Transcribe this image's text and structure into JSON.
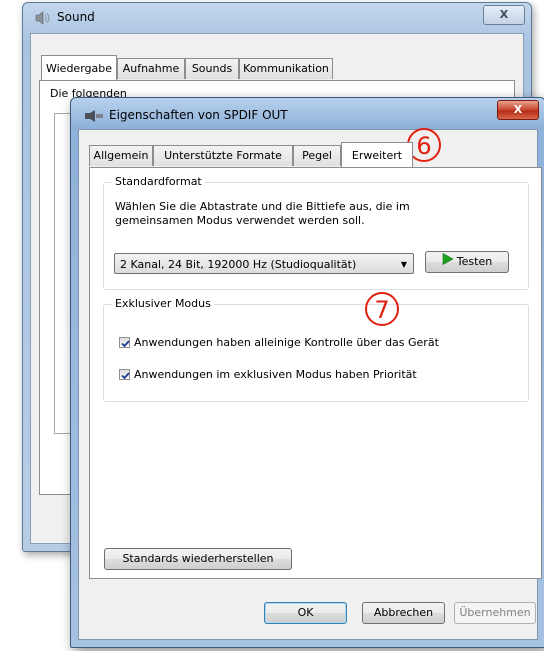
{
  "sound_window": {
    "title": "Sound",
    "close_label": "X",
    "tabs": [
      "Wiedergabe",
      "Aufnahme",
      "Sounds",
      "Kommunikation"
    ],
    "pane_text": "Die folgenden"
  },
  "dialog": {
    "title": "Eigenschaften von SPDIF OUT",
    "close_label": "X",
    "tabs": [
      "Allgemein",
      "Unterstützte Formate",
      "Pegel",
      "Erweitert"
    ],
    "standard_format": {
      "label": "Standardformat",
      "description_line1": "Wählen Sie die Abtastrate und die Bittiefe aus, die im",
      "description_line2": "gemeinsamen Modus verwendet werden soll.",
      "selected_format": "2 Kanal, 24 Bit, 192000 Hz (Studioqualität)",
      "test_button": "Testen"
    },
    "exclusive_mode": {
      "label": "Exklusiver Modus",
      "option1": "Anwendungen haben alleinige Kontrolle über das Gerät",
      "option1_checked": true,
      "option2": "Anwendungen im exklusiven Modus haben Priorität",
      "option2_checked": true
    },
    "restore_button": "Standards wiederherstellen",
    "ok_button": "OK",
    "cancel_button": "Abbrechen",
    "apply_button": "Übernehmen"
  },
  "annotations": {
    "marker_tab": "6",
    "marker_group": "7",
    "marker_color": "#e02010"
  }
}
